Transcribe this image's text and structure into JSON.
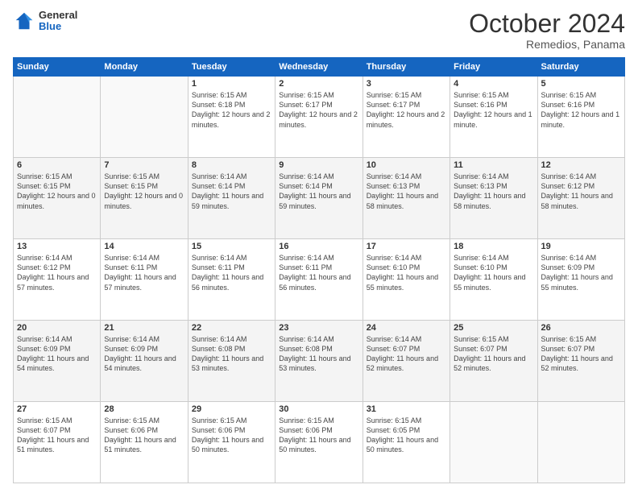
{
  "header": {
    "logo_general": "General",
    "logo_blue": "Blue",
    "month_title": "October 2024",
    "subtitle": "Remedios, Panama"
  },
  "days_of_week": [
    "Sunday",
    "Monday",
    "Tuesday",
    "Wednesday",
    "Thursday",
    "Friday",
    "Saturday"
  ],
  "weeks": [
    [
      {
        "day": "",
        "sunrise": "",
        "sunset": "",
        "daylight": "",
        "empty": true
      },
      {
        "day": "",
        "sunrise": "",
        "sunset": "",
        "daylight": "",
        "empty": true
      },
      {
        "day": "1",
        "sunrise": "Sunrise: 6:15 AM",
        "sunset": "Sunset: 6:18 PM",
        "daylight": "Daylight: 12 hours and 2 minutes."
      },
      {
        "day": "2",
        "sunrise": "Sunrise: 6:15 AM",
        "sunset": "Sunset: 6:17 PM",
        "daylight": "Daylight: 12 hours and 2 minutes."
      },
      {
        "day": "3",
        "sunrise": "Sunrise: 6:15 AM",
        "sunset": "Sunset: 6:17 PM",
        "daylight": "Daylight: 12 hours and 2 minutes."
      },
      {
        "day": "4",
        "sunrise": "Sunrise: 6:15 AM",
        "sunset": "Sunset: 6:16 PM",
        "daylight": "Daylight: 12 hours and 1 minute."
      },
      {
        "day": "5",
        "sunrise": "Sunrise: 6:15 AM",
        "sunset": "Sunset: 6:16 PM",
        "daylight": "Daylight: 12 hours and 1 minute."
      }
    ],
    [
      {
        "day": "6",
        "sunrise": "Sunrise: 6:15 AM",
        "sunset": "Sunset: 6:15 PM",
        "daylight": "Daylight: 12 hours and 0 minutes."
      },
      {
        "day": "7",
        "sunrise": "Sunrise: 6:15 AM",
        "sunset": "Sunset: 6:15 PM",
        "daylight": "Daylight: 12 hours and 0 minutes."
      },
      {
        "day": "8",
        "sunrise": "Sunrise: 6:14 AM",
        "sunset": "Sunset: 6:14 PM",
        "daylight": "Daylight: 11 hours and 59 minutes."
      },
      {
        "day": "9",
        "sunrise": "Sunrise: 6:14 AM",
        "sunset": "Sunset: 6:14 PM",
        "daylight": "Daylight: 11 hours and 59 minutes."
      },
      {
        "day": "10",
        "sunrise": "Sunrise: 6:14 AM",
        "sunset": "Sunset: 6:13 PM",
        "daylight": "Daylight: 11 hours and 58 minutes."
      },
      {
        "day": "11",
        "sunrise": "Sunrise: 6:14 AM",
        "sunset": "Sunset: 6:13 PM",
        "daylight": "Daylight: 11 hours and 58 minutes."
      },
      {
        "day": "12",
        "sunrise": "Sunrise: 6:14 AM",
        "sunset": "Sunset: 6:12 PM",
        "daylight": "Daylight: 11 hours and 58 minutes."
      }
    ],
    [
      {
        "day": "13",
        "sunrise": "Sunrise: 6:14 AM",
        "sunset": "Sunset: 6:12 PM",
        "daylight": "Daylight: 11 hours and 57 minutes."
      },
      {
        "day": "14",
        "sunrise": "Sunrise: 6:14 AM",
        "sunset": "Sunset: 6:11 PM",
        "daylight": "Daylight: 11 hours and 57 minutes."
      },
      {
        "day": "15",
        "sunrise": "Sunrise: 6:14 AM",
        "sunset": "Sunset: 6:11 PM",
        "daylight": "Daylight: 11 hours and 56 minutes."
      },
      {
        "day": "16",
        "sunrise": "Sunrise: 6:14 AM",
        "sunset": "Sunset: 6:11 PM",
        "daylight": "Daylight: 11 hours and 56 minutes."
      },
      {
        "day": "17",
        "sunrise": "Sunrise: 6:14 AM",
        "sunset": "Sunset: 6:10 PM",
        "daylight": "Daylight: 11 hours and 55 minutes."
      },
      {
        "day": "18",
        "sunrise": "Sunrise: 6:14 AM",
        "sunset": "Sunset: 6:10 PM",
        "daylight": "Daylight: 11 hours and 55 minutes."
      },
      {
        "day": "19",
        "sunrise": "Sunrise: 6:14 AM",
        "sunset": "Sunset: 6:09 PM",
        "daylight": "Daylight: 11 hours and 55 minutes."
      }
    ],
    [
      {
        "day": "20",
        "sunrise": "Sunrise: 6:14 AM",
        "sunset": "Sunset: 6:09 PM",
        "daylight": "Daylight: 11 hours and 54 minutes."
      },
      {
        "day": "21",
        "sunrise": "Sunrise: 6:14 AM",
        "sunset": "Sunset: 6:09 PM",
        "daylight": "Daylight: 11 hours and 54 minutes."
      },
      {
        "day": "22",
        "sunrise": "Sunrise: 6:14 AM",
        "sunset": "Sunset: 6:08 PM",
        "daylight": "Daylight: 11 hours and 53 minutes."
      },
      {
        "day": "23",
        "sunrise": "Sunrise: 6:14 AM",
        "sunset": "Sunset: 6:08 PM",
        "daylight": "Daylight: 11 hours and 53 minutes."
      },
      {
        "day": "24",
        "sunrise": "Sunrise: 6:14 AM",
        "sunset": "Sunset: 6:07 PM",
        "daylight": "Daylight: 11 hours and 52 minutes."
      },
      {
        "day": "25",
        "sunrise": "Sunrise: 6:15 AM",
        "sunset": "Sunset: 6:07 PM",
        "daylight": "Daylight: 11 hours and 52 minutes."
      },
      {
        "day": "26",
        "sunrise": "Sunrise: 6:15 AM",
        "sunset": "Sunset: 6:07 PM",
        "daylight": "Daylight: 11 hours and 52 minutes."
      }
    ],
    [
      {
        "day": "27",
        "sunrise": "Sunrise: 6:15 AM",
        "sunset": "Sunset: 6:07 PM",
        "daylight": "Daylight: 11 hours and 51 minutes."
      },
      {
        "day": "28",
        "sunrise": "Sunrise: 6:15 AM",
        "sunset": "Sunset: 6:06 PM",
        "daylight": "Daylight: 11 hours and 51 minutes."
      },
      {
        "day": "29",
        "sunrise": "Sunrise: 6:15 AM",
        "sunset": "Sunset: 6:06 PM",
        "daylight": "Daylight: 11 hours and 50 minutes."
      },
      {
        "day": "30",
        "sunrise": "Sunrise: 6:15 AM",
        "sunset": "Sunset: 6:06 PM",
        "daylight": "Daylight: 11 hours and 50 minutes."
      },
      {
        "day": "31",
        "sunrise": "Sunrise: 6:15 AM",
        "sunset": "Sunset: 6:05 PM",
        "daylight": "Daylight: 11 hours and 50 minutes."
      },
      {
        "day": "",
        "sunrise": "",
        "sunset": "",
        "daylight": "",
        "empty": true
      },
      {
        "day": "",
        "sunrise": "",
        "sunset": "",
        "daylight": "",
        "empty": true
      }
    ]
  ]
}
